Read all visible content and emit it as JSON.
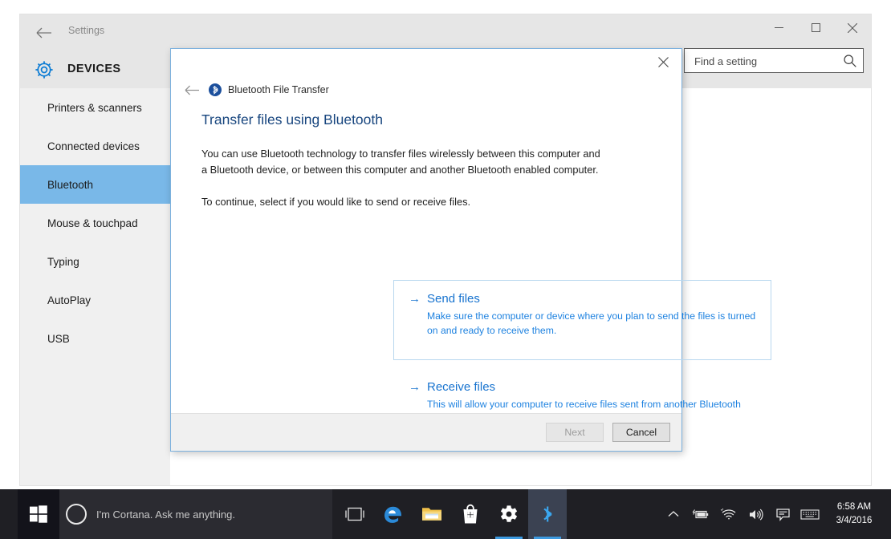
{
  "window": {
    "back_icon": "arrow-left-icon",
    "title": "Settings",
    "minimize_label": "Minimize",
    "maximize_label": "Restore",
    "close_label": "Close"
  },
  "header": {
    "icon": "gear-icon",
    "title": "DEVICES"
  },
  "search": {
    "placeholder": "Find a setting",
    "value": "",
    "icon": "search-icon"
  },
  "sidebar": {
    "items": [
      {
        "label": "Printers & scanners",
        "selected": false
      },
      {
        "label": "Connected devices",
        "selected": false
      },
      {
        "label": "Bluetooth",
        "selected": true
      },
      {
        "label": "Mouse & touchpad",
        "selected": false
      },
      {
        "label": "Typing",
        "selected": false
      },
      {
        "label": "AutoPlay",
        "selected": false
      },
      {
        "label": "USB",
        "selected": false
      }
    ],
    "selected_bg": "#79b8e8"
  },
  "dialog": {
    "close_icon": "close-icon",
    "back_icon": "arrow-left-icon",
    "breadcrumb_icon": "bluetooth-icon",
    "breadcrumb": "Bluetooth File Transfer",
    "heading": "Transfer files using Bluetooth",
    "paragraph1": "You can use Bluetooth technology to transfer files wirelessly between this computer and a Bluetooth device, or between this computer and another Bluetooth enabled computer.",
    "paragraph2": "To continue, select if you would like to send or receive files.",
    "heading_color": "#17457e",
    "link_color": "#1773cf",
    "options": [
      {
        "arrow": "arrow-right-icon",
        "title": "Send files",
        "description": "Make sure the computer or device where you plan to send the files is turned on and ready to receive them.",
        "boxed": true
      },
      {
        "arrow": "arrow-right-icon",
        "title": "Receive files",
        "description": "This will allow your computer to receive files sent from another Bluetooth enabled computer or device.",
        "boxed": false
      }
    ],
    "footer": {
      "next_label": "Next",
      "next_disabled": true,
      "cancel_label": "Cancel"
    }
  },
  "taskbar": {
    "start_icon": "windows-start-icon",
    "cortana": {
      "icon": "cortana-circle-icon",
      "placeholder": "I'm Cortana. Ask me anything."
    },
    "apps": [
      {
        "name": "task-view-icon",
        "label": "Task View"
      },
      {
        "name": "edge-icon",
        "label": "Microsoft Edge"
      },
      {
        "name": "file-explorer-icon",
        "label": "File Explorer"
      },
      {
        "name": "store-icon",
        "label": "Store"
      },
      {
        "name": "settings-gear-icon",
        "label": "Settings"
      },
      {
        "name": "bluetooth-icon",
        "label": "Bluetooth"
      }
    ],
    "tray": [
      {
        "name": "chevron-up-icon",
        "label": "Show hidden icons"
      },
      {
        "name": "battery-icon",
        "label": "Battery"
      },
      {
        "name": "wifi-icon",
        "label": "Network"
      },
      {
        "name": "volume-icon",
        "label": "Volume"
      },
      {
        "name": "action-center-icon",
        "label": "Action Center"
      },
      {
        "name": "keyboard-icon",
        "label": "Touch keyboard"
      }
    ],
    "clock": {
      "time": "6:58 AM",
      "date": "3/4/2016"
    }
  }
}
